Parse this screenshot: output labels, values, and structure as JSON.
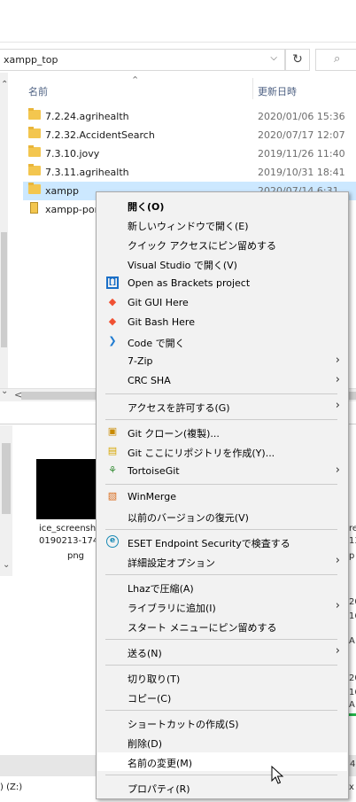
{
  "explorer_top": {
    "address": "xampp_top",
    "refresh_icon": "refresh-icon",
    "search_icon": "search-icon",
    "columns": {
      "name": "名前",
      "date": "更新日時"
    },
    "files": [
      {
        "name": "7.2.24.agrihealth",
        "date": "2020/01/06 15:36",
        "icon": "folder-icon"
      },
      {
        "name": "7.2.32.AccidentSearch",
        "date": "2020/07/17 12:07",
        "icon": "folder-icon"
      },
      {
        "name": "7.3.10.jovy",
        "date": "2019/11/26 11:40",
        "icon": "folder-icon"
      },
      {
        "name": "7.3.11.agrihealth",
        "date": "2019/10/31 18:41",
        "icon": "folder-icon"
      },
      {
        "name": "xampp",
        "date": "2020/07/14 6:31",
        "icon": "folder-icon",
        "selected": true
      },
      {
        "name": "xampp-por",
        "date": "",
        "icon": "zip-folder-icon"
      }
    ]
  },
  "explorer_bottom": {
    "thumbnail_caption": [
      "ice_screensh",
      "0190213-174",
      "png"
    ],
    "right_caption": [
      "re",
      "13",
      "p"
    ],
    "right_edge_text": [
      "20",
      "16",
      "A",
      "20",
      "16",
      "A",
      "4"
    ],
    "drive_label": ") (Z:)",
    "status_right": "x"
  },
  "context_menu": {
    "items": [
      {
        "label": "開く(O)",
        "bold": true
      },
      {
        "label": "新しいウィンドウで開く(E)"
      },
      {
        "label": "クイック アクセスにピン留めする"
      },
      {
        "label": "Visual Studio で開く(V)"
      },
      {
        "label": "Open as Brackets project",
        "icon": "brackets-icon"
      },
      {
        "label": "Git GUI Here",
        "icon": "git-icon"
      },
      {
        "label": "Git Bash Here",
        "icon": "git-icon"
      },
      {
        "label": "Code で開く",
        "icon": "vscode-icon"
      },
      {
        "label": "7-Zip",
        "submenu": true
      },
      {
        "label": "CRC SHA",
        "submenu": true
      },
      {
        "label": "アクセスを許可する(G)",
        "submenu": true
      },
      {
        "label": "Git クローン(複製)...",
        "icon": "git-clone-icon"
      },
      {
        "label": "Git ここにリポジトリを作成(Y)...",
        "icon": "create-repo-icon"
      },
      {
        "label": "TortoiseGit",
        "icon": "tortoisegit-icon",
        "submenu": true
      },
      {
        "label": "WinMerge",
        "icon": "winmerge-icon"
      },
      {
        "label": "以前のバージョンの復元(V)"
      },
      {
        "label": "ESET Endpoint Securityで検査する",
        "icon": "eset-icon"
      },
      {
        "label": "詳細設定オプション",
        "submenu": true
      },
      {
        "label": "Lhazで圧縮(A)"
      },
      {
        "label": "ライブラリに追加(I)",
        "submenu": true
      },
      {
        "label": "スタート メニューにピン留めする"
      },
      {
        "label": "送る(N)",
        "submenu": true
      },
      {
        "label": "切り取り(T)"
      },
      {
        "label": "コピー(C)"
      },
      {
        "label": "ショートカットの作成(S)"
      },
      {
        "label": "削除(D)"
      },
      {
        "label": "名前の変更(M)",
        "hovered": true
      },
      {
        "label": "プロパティ(R)"
      }
    ],
    "submenu_arrow": "›"
  }
}
